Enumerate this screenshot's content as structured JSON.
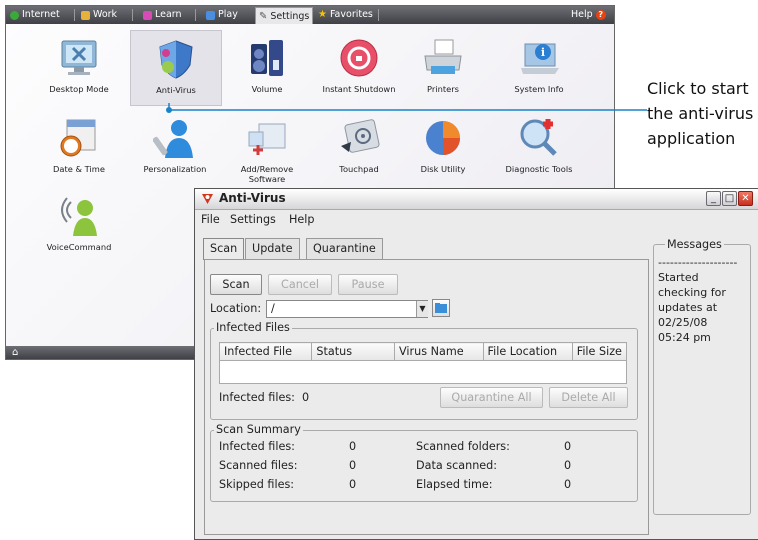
{
  "launcher": {
    "tabs": [
      {
        "label": "Internet",
        "icon": "globe-icon"
      },
      {
        "label": "Work",
        "icon": "folder-icon"
      },
      {
        "label": "Learn",
        "icon": "book-icon"
      },
      {
        "label": "Play",
        "icon": "gamepad-icon"
      },
      {
        "label": "Settings",
        "icon": "wrench-icon",
        "active": true
      },
      {
        "label": "Favorites",
        "icon": "star-icon"
      }
    ],
    "help_label": "Help",
    "apps": [
      {
        "label": "Desktop Mode"
      },
      {
        "label": "Anti-Virus",
        "selected": true
      },
      {
        "label": "Volume"
      },
      {
        "label": "Instant Shutdown"
      },
      {
        "label": "Printers"
      },
      {
        "label": "System Info"
      },
      {
        "label": "Date & Time"
      },
      {
        "label": "Personalization"
      },
      {
        "label": "Add/Remove Software"
      },
      {
        "label": "Touchpad"
      },
      {
        "label": "Disk Utility"
      },
      {
        "label": "Diagnostic Tools"
      },
      {
        "label": "VoiceCommand"
      }
    ]
  },
  "callout": {
    "line1": "Click to start",
    "line2": "the anti-virus",
    "line3": "application"
  },
  "av": {
    "title": "Anti-Virus",
    "menu": [
      "File",
      "Settings",
      "Help"
    ],
    "tabs": [
      "Scan",
      "Update",
      "Quarantine"
    ],
    "buttons": {
      "scan": "Scan",
      "cancel": "Cancel",
      "pause": "Pause",
      "quarantine_all": "Quarantine All",
      "delete_all": "Delete All"
    },
    "location_label": "Location:",
    "location_value": "/",
    "infected_group": "Infected Files",
    "columns": [
      "Infected File",
      "Status",
      "Virus Name",
      "File Location",
      "File Size"
    ],
    "infected_count_label": "Infected files:",
    "infected_count_value": "0",
    "summary_group": "Scan Summary",
    "summary": [
      {
        "label": "Infected files:",
        "value": "0"
      },
      {
        "label": "Scanned files:",
        "value": "0"
      },
      {
        "label": "Skipped files:",
        "value": "0"
      },
      {
        "label": "Scanned folders:",
        "value": "0"
      },
      {
        "label": "Data scanned:",
        "value": "0"
      },
      {
        "label": "Elapsed time:",
        "value": "0"
      }
    ],
    "messages_title": "Messages",
    "messages_separator": "--------------------",
    "messages": [
      "Started",
      "checking for",
      "updates at",
      "02/25/08",
      "05:24 pm"
    ]
  },
  "colors": {
    "accent": "#1883c9",
    "title_red": "#d2361c",
    "taskbar": "#4a4c51"
  }
}
